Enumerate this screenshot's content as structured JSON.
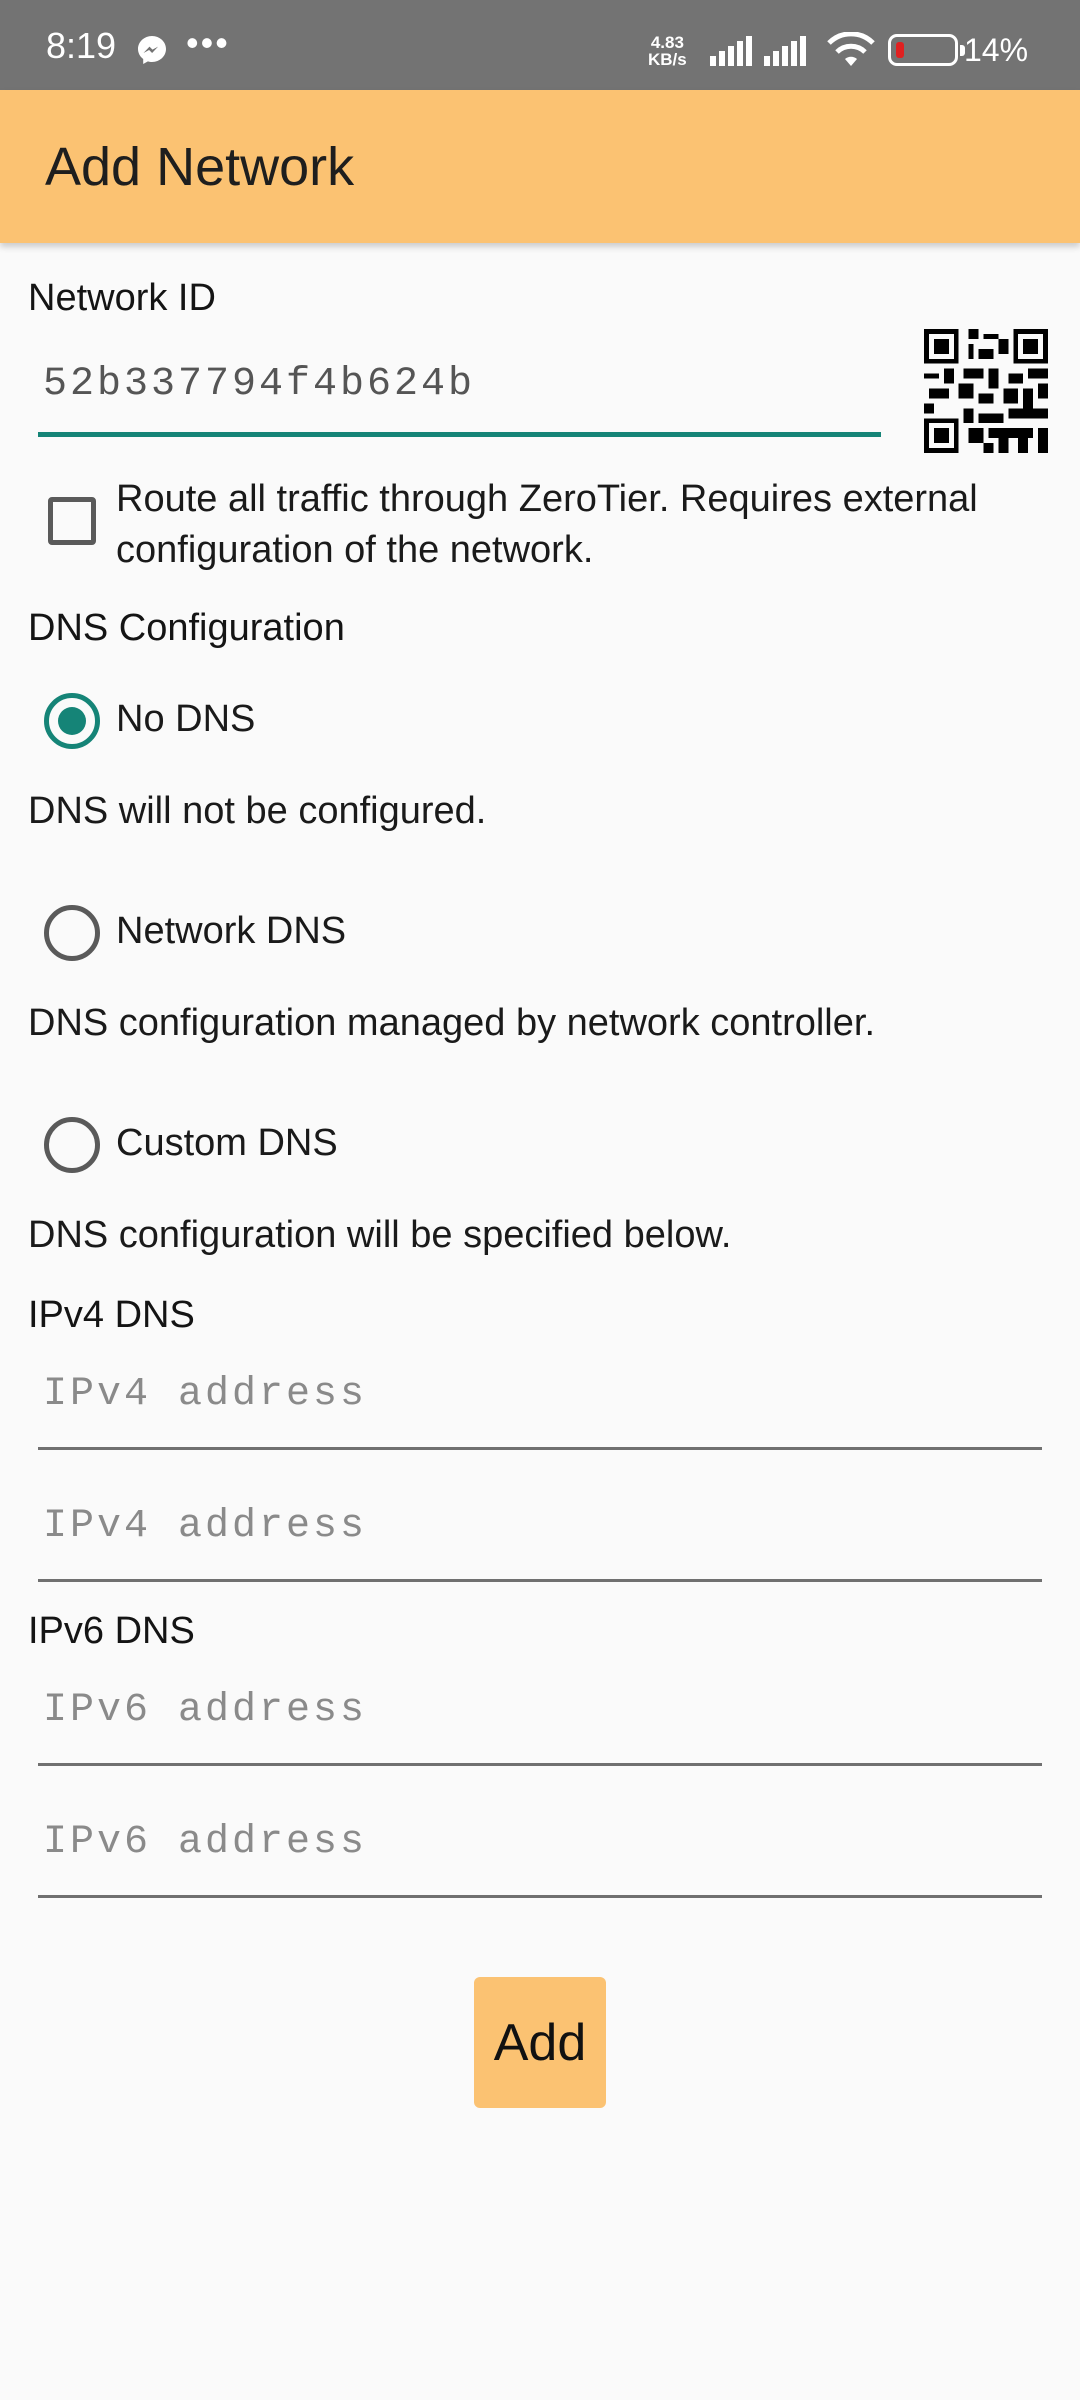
{
  "status_bar": {
    "time": "8:19",
    "dots": "•••",
    "speed_value": "4.83",
    "speed_unit": "KB/s",
    "battery": "14%",
    "icons": [
      "messenger-icon",
      "signal-icon",
      "signal-icon",
      "wifi-icon",
      "battery-icon"
    ]
  },
  "app_bar": {
    "title": "Add Network"
  },
  "network_id": {
    "label": "Network ID",
    "value": "52b337794f4b624b",
    "qr_icon": "qr-code-icon"
  },
  "route_all": {
    "checked": false,
    "text": "Route all traffic through ZeroTier. Requires external configuration of the network."
  },
  "dns": {
    "section_label": "DNS Configuration",
    "options": [
      {
        "label": "No DNS",
        "description": "DNS will not be configured.",
        "selected": true
      },
      {
        "label": "Network DNS",
        "description": "DNS configuration managed by network controller.",
        "selected": false
      },
      {
        "label": "Custom DNS",
        "description": "DNS configuration will be specified below.",
        "selected": false
      }
    ]
  },
  "ipv4": {
    "label": "IPv4 DNS",
    "fields": [
      {
        "placeholder": "IPv4 address",
        "value": ""
      },
      {
        "placeholder": "IPv4 address",
        "value": ""
      }
    ]
  },
  "ipv6": {
    "label": "IPv6 DNS",
    "fields": [
      {
        "placeholder": "IPv6 address",
        "value": ""
      },
      {
        "placeholder": "IPv6 address",
        "value": ""
      }
    ]
  },
  "add_button": {
    "label": "Add"
  },
  "colors": {
    "accent": "#158477",
    "app_bar": "#fbc272",
    "status_bar": "#737373",
    "background": "#fafafa"
  }
}
